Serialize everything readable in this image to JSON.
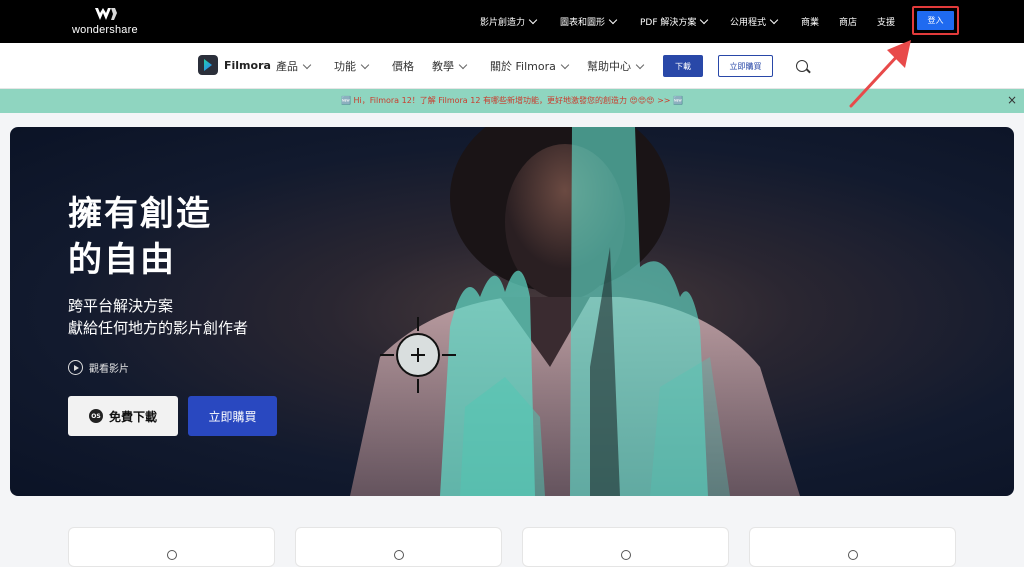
{
  "colors": {
    "topbar": "#000000",
    "login_blue": "#1f6af0",
    "highlight_red": "#e23b3b",
    "banner_green": "#8fd5c0",
    "accent_blue": "#2948c0",
    "hero_bg": "#0b1326"
  },
  "topbar": {
    "logo_text": "wondershare",
    "nav": [
      {
        "label": "影片創造力",
        "dropdown": true
      },
      {
        "label": "圖表和圖形",
        "dropdown": true
      },
      {
        "label": "PDF 解決方案",
        "dropdown": true
      },
      {
        "label": "公用程式",
        "dropdown": true
      },
      {
        "label": "商業",
        "dropdown": false
      },
      {
        "label": "商店",
        "dropdown": false
      },
      {
        "label": "支援",
        "dropdown": false
      }
    ],
    "login_label": "登入"
  },
  "subbar": {
    "brand": "Filmora",
    "nav": [
      {
        "label": "產品",
        "dropdown": true
      },
      {
        "label": "功能",
        "dropdown": true
      },
      {
        "label": "價格",
        "dropdown": false
      },
      {
        "label": "教學",
        "dropdown": true
      },
      {
        "label": "關於 Filmora",
        "dropdown": true
      },
      {
        "label": "幫助中心",
        "dropdown": true
      }
    ],
    "download_label": "下載",
    "buy_label": "立即購買",
    "search_icon": "search-icon"
  },
  "banner": {
    "text": "🆕 Hi，Filmora 12！了解 Filmora 12 有哪些新增功能，更好地激發您的創造力 😍😍😍 >> 🆕",
    "close": "×"
  },
  "hero": {
    "title_line1": "擁有創造",
    "title_line2": "的自由",
    "subtitle_line1": "跨平台解決方案",
    "subtitle_line2": "獻給任何地方的影片創作者",
    "watch_label": "觀看影片",
    "free_download_label": "免費下載",
    "os_icon_text": "OS",
    "buy_now_label": "立即購買"
  }
}
